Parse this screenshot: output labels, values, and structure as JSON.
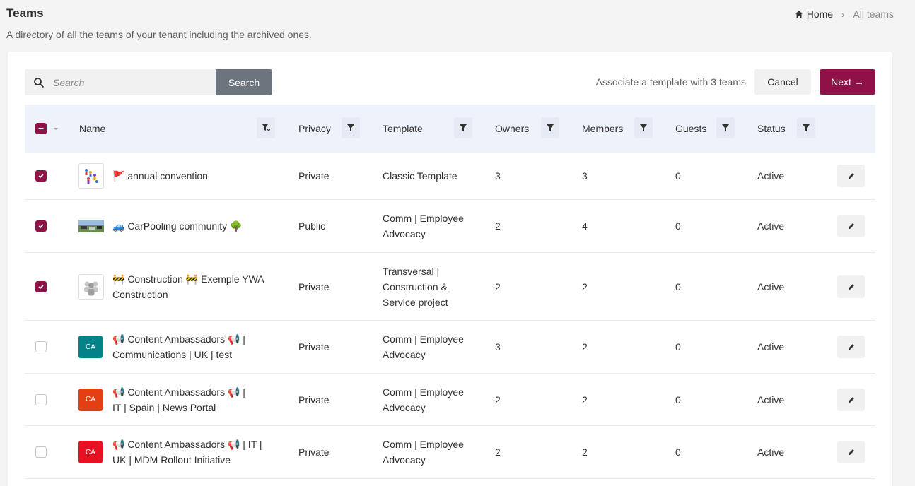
{
  "header": {
    "title": "Teams",
    "subtitle": "A directory of all the teams of your tenant including the archived ones.",
    "breadcrumb": {
      "home": "Home",
      "separator": "›",
      "current": "All teams"
    }
  },
  "toolbar": {
    "search_placeholder": "Search",
    "search_button": "Search",
    "assoc_text": "Associate a template with 3 teams",
    "cancel_label": "Cancel",
    "next_label": "Next →"
  },
  "columns": {
    "name": "Name",
    "privacy": "Privacy",
    "template": "Template",
    "owners": "Owners",
    "members": "Members",
    "guests": "Guests",
    "status": "Status"
  },
  "rows": [
    {
      "checked": true,
      "name": "🚩 annual convention",
      "avatar": "image-people",
      "avatar_text": "",
      "privacy": "Private",
      "template": "Classic Template",
      "owners": "3",
      "members": "3",
      "guests": "0",
      "status": "Active"
    },
    {
      "checked": true,
      "name": "🚙 CarPooling community 🌳",
      "avatar": "image-cars",
      "avatar_text": "",
      "privacy": "Public",
      "template": "Comm | Employee Advocacy",
      "owners": "2",
      "members": "4",
      "guests": "0",
      "status": "Active"
    },
    {
      "checked": true,
      "name": "🚧 Construction 🚧 Exemple YWA Construction",
      "avatar": "image-group",
      "avatar_text": "",
      "privacy": "Private",
      "template": "Transversal | Construction & Service project",
      "owners": "2",
      "members": "2",
      "guests": "0",
      "status": "Active"
    },
    {
      "checked": false,
      "name": "📢 Content Ambassadors 📢 | Communications | UK | test",
      "avatar": "initials",
      "avatar_text": "CA",
      "avatar_color": "#038387",
      "privacy": "Private",
      "template": "Comm | Employee Advocacy",
      "owners": "3",
      "members": "2",
      "guests": "0",
      "status": "Active"
    },
    {
      "checked": false,
      "name": "📢 Content Ambassadors 📢 | IT | Spain | News Portal",
      "avatar": "initials",
      "avatar_text": "CA",
      "avatar_color": "#e43e15",
      "privacy": "Private",
      "template": "Comm | Employee Advocacy",
      "owners": "2",
      "members": "2",
      "guests": "0",
      "status": "Active"
    },
    {
      "checked": false,
      "name": "📢 Content Ambassadors 📢 | IT | UK | MDM Rollout Initiative",
      "avatar": "initials",
      "avatar_text": "CA",
      "avatar_color": "#e81123",
      "privacy": "Private",
      "template": "Comm | Employee Advocacy",
      "owners": "2",
      "members": "2",
      "guests": "0",
      "status": "Active"
    }
  ],
  "colors": {
    "accent": "#8e1248",
    "header_bg": "#eef2fb",
    "search_btn": "#6c757d"
  }
}
